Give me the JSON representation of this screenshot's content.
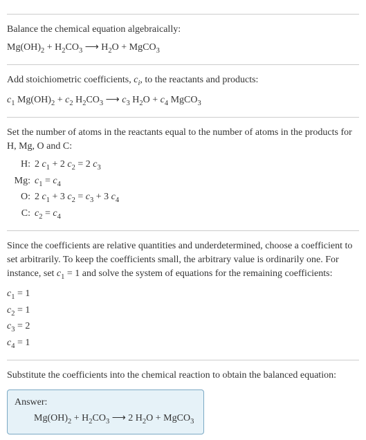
{
  "section1": {
    "intro": "Balance the chemical equation algebraically:",
    "equation": "Mg(OH)<sub>2</sub> + H<sub>2</sub>CO<sub>3</sub>  ⟶  H<sub>2</sub>O + MgCO<sub>3</sub>"
  },
  "section2": {
    "intro": "Add stoichiometric coefficients, <span class=\"ital\">c<sub>i</sub></span>, to the reactants and products:",
    "equation": "<span class=\"ital\">c</span><sub>1</sub> Mg(OH)<sub>2</sub> + <span class=\"ital\">c</span><sub>2</sub> H<sub>2</sub>CO<sub>3</sub>  ⟶  <span class=\"ital\">c</span><sub>3</sub> H<sub>2</sub>O + <span class=\"ital\">c</span><sub>4</sub> MgCO<sub>3</sub>"
  },
  "section3": {
    "intro": "Set the number of atoms in the reactants equal to the number of atoms in the products for H, Mg, O and C:",
    "rows": [
      {
        "label": "H:",
        "eq": "2 <span class=\"ital\">c</span><sub>1</sub> + 2 <span class=\"ital\">c</span><sub>2</sub> = 2 <span class=\"ital\">c</span><sub>3</sub>"
      },
      {
        "label": "Mg:",
        "eq": "<span class=\"ital\">c</span><sub>1</sub> = <span class=\"ital\">c</span><sub>4</sub>"
      },
      {
        "label": "O:",
        "eq": "2 <span class=\"ital\">c</span><sub>1</sub> + 3 <span class=\"ital\">c</span><sub>2</sub> = <span class=\"ital\">c</span><sub>3</sub> + 3 <span class=\"ital\">c</span><sub>4</sub>"
      },
      {
        "label": "C:",
        "eq": "<span class=\"ital\">c</span><sub>2</sub> = <span class=\"ital\">c</span><sub>4</sub>"
      }
    ]
  },
  "section4": {
    "intro": "Since the coefficients are relative quantities and underdetermined, choose a coefficient to set arbitrarily. To keep the coefficients small, the arbitrary value is ordinarily one. For instance, set <span class=\"ital\">c</span><sub>1</sub> = 1 and solve the system of equations for the remaining coefficients:",
    "coeffs": [
      "<span class=\"ital\">c</span><sub>1</sub> = 1",
      "<span class=\"ital\">c</span><sub>2</sub> = 1",
      "<span class=\"ital\">c</span><sub>3</sub> = 2",
      "<span class=\"ital\">c</span><sub>4</sub> = 1"
    ]
  },
  "section5": {
    "intro": "Substitute the coefficients into the chemical reaction to obtain the balanced equation:",
    "answer_label": "Answer:",
    "answer_eq": "Mg(OH)<sub>2</sub> + H<sub>2</sub>CO<sub>3</sub>  ⟶  2 H<sub>2</sub>O + MgCO<sub>3</sub>"
  }
}
